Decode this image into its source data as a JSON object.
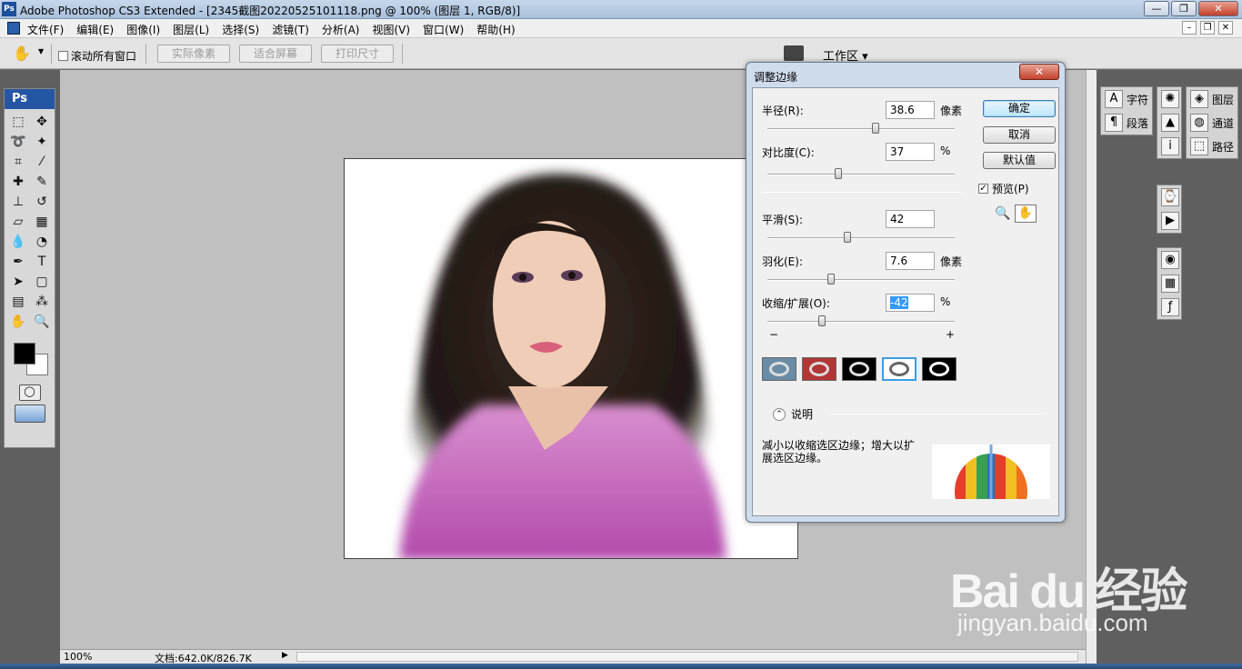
{
  "window": {
    "app_icon": "Ps",
    "title": "Adobe Photoshop CS3 Extended - [2345截图20220525101118.png @ 100% (图层 1, RGB/8)]"
  },
  "menu": [
    "文件(F)",
    "编辑(E)",
    "图像(I)",
    "图层(L)",
    "选择(S)",
    "滤镜(T)",
    "分析(A)",
    "视图(V)",
    "窗口(W)",
    "帮助(H)"
  ],
  "options": {
    "scroll_all_label": "滚动所有窗口",
    "actual_pixels": "实际像素",
    "fit_screen": "适合屏幕",
    "print_size": "打印尺寸",
    "workspace": "工作区 ▾"
  },
  "toolbox": {
    "logo": "Ps"
  },
  "status": {
    "zoom": "100%",
    "doc_info": "文档:642.0K/826.7K"
  },
  "panels": {
    "col1": [
      "字符",
      "段落"
    ],
    "col3": [
      "图层",
      "通道",
      "路径"
    ]
  },
  "dialog": {
    "title": "调整边缘",
    "radius": {
      "label": "半径(R):",
      "value": "38.6",
      "unit": "像素",
      "slider": 0.6
    },
    "contrast": {
      "label": "对比度(C):",
      "value": "37",
      "unit": "%",
      "slider": 0.37
    },
    "smooth": {
      "label": "平滑(S):",
      "value": "42",
      "slider": 0.42
    },
    "feather": {
      "label": "羽化(E):",
      "value": "7.6",
      "unit": "像素",
      "slider": 0.34
    },
    "contract": {
      "label": "收缩/扩展(O):",
      "value": "-42",
      "unit": "%",
      "slider": 0.29,
      "minus": "−",
      "plus": "+"
    },
    "buttons": {
      "ok": "确定",
      "cancel": "取消",
      "default": "默认值"
    },
    "preview_label": "预览(P)",
    "description_toggle": "说明",
    "description": "减小以收缩选区边缘；增大以扩展选区边缘。"
  },
  "watermark": {
    "brand": "Bai du 经验",
    "url": "jingyan.baidu.com"
  }
}
